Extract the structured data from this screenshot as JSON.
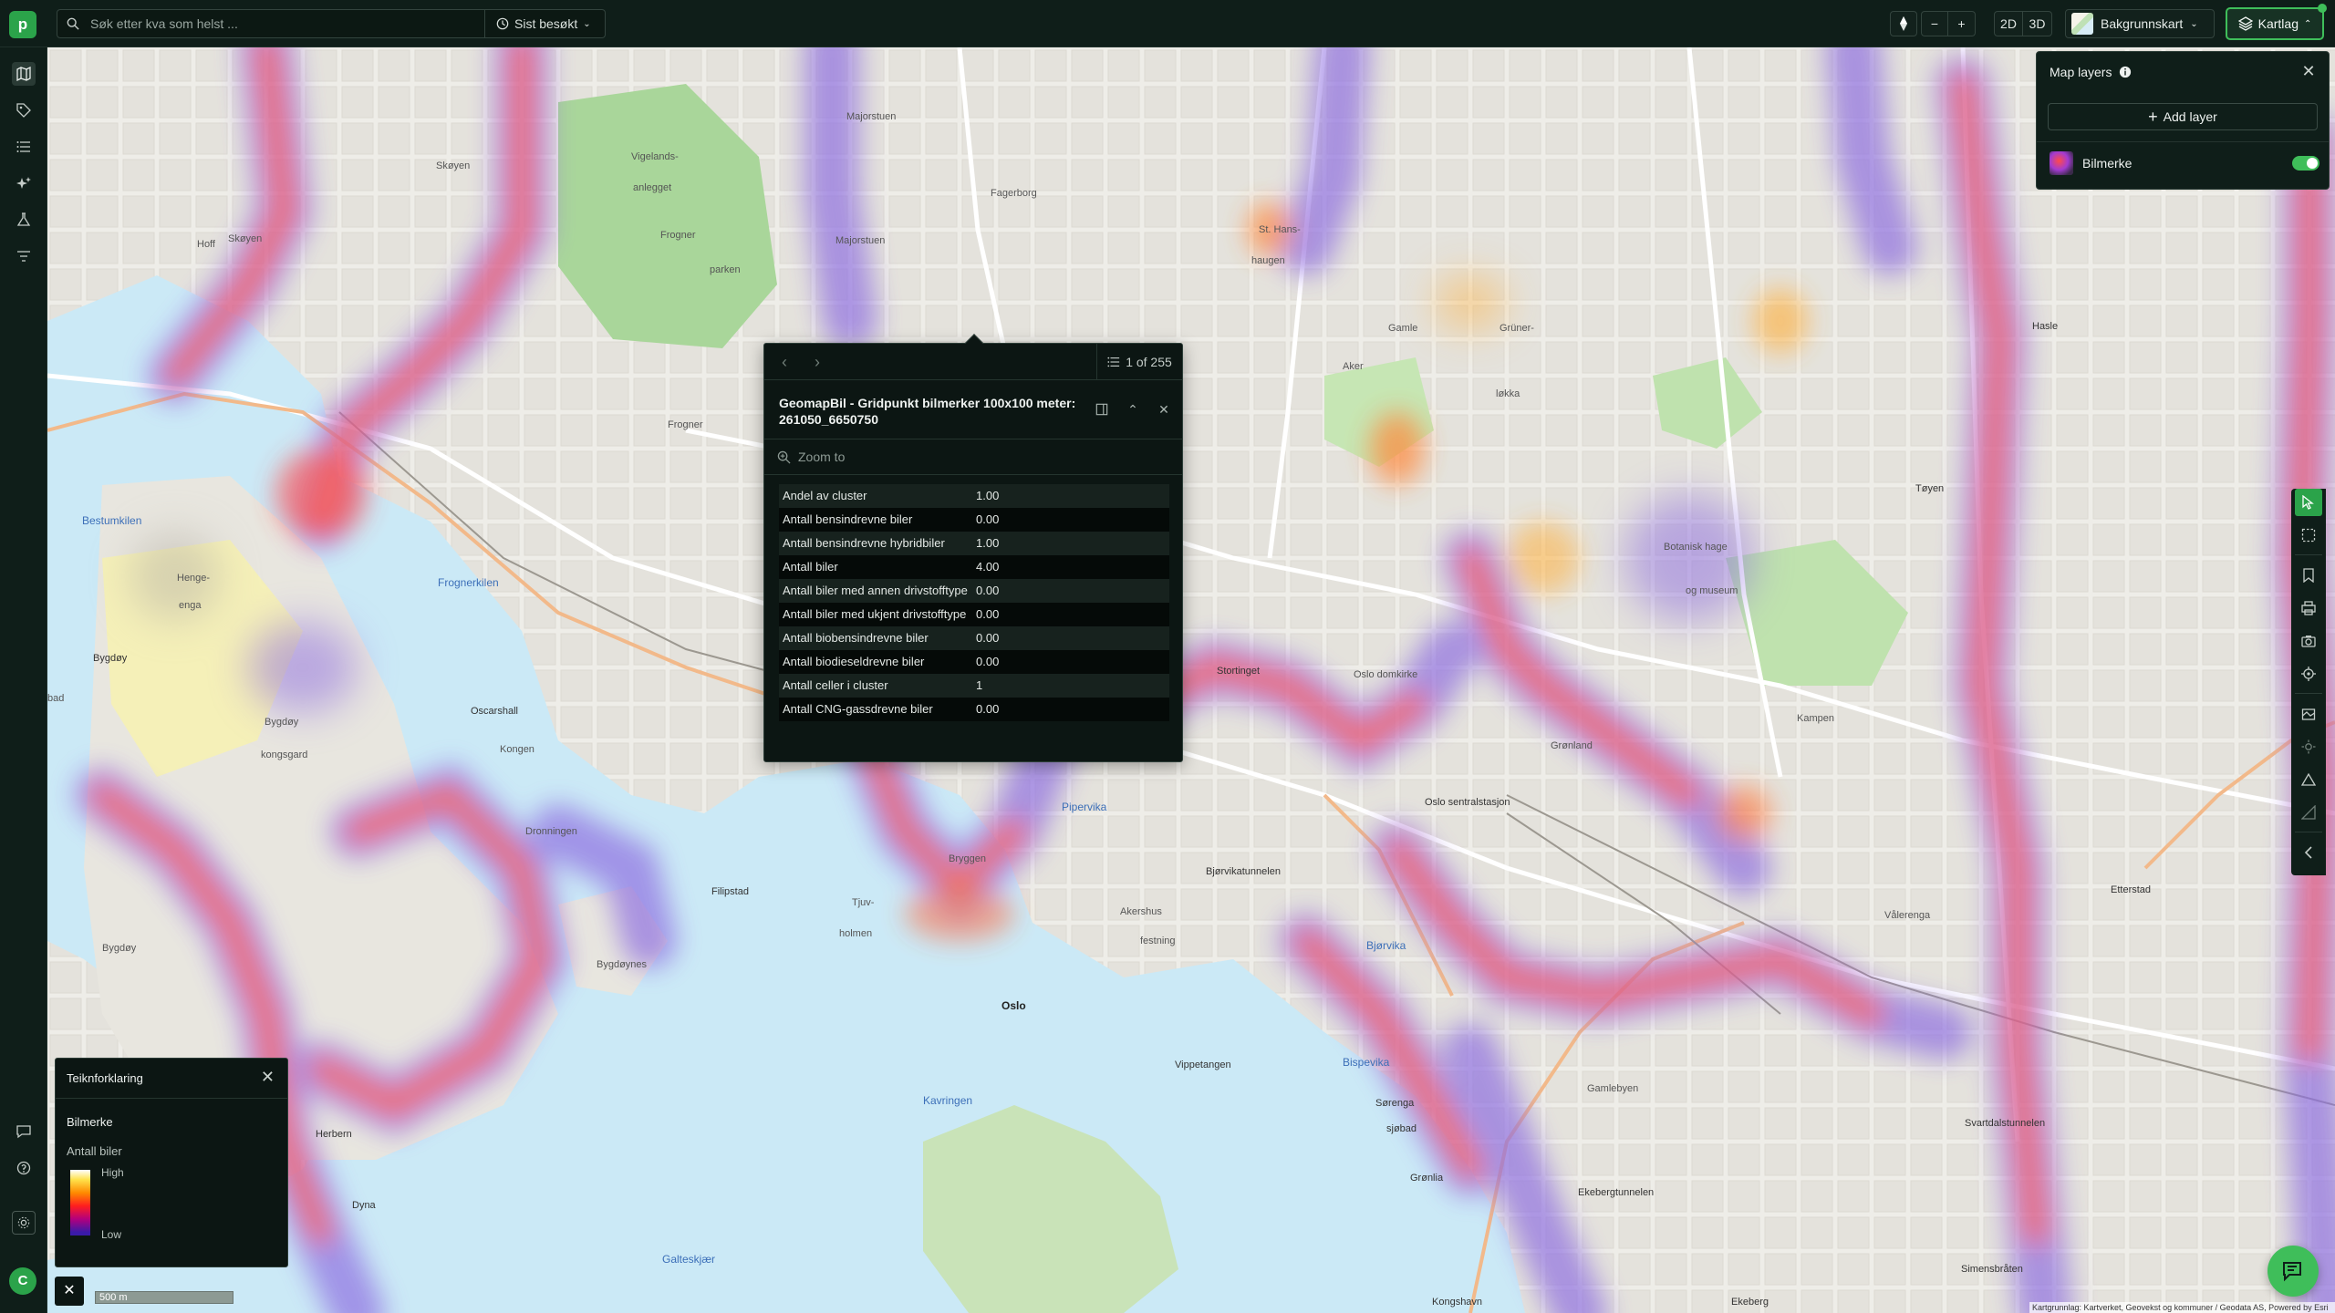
{
  "app": {
    "logo_letter": "p",
    "brand_color": "#2ba34a"
  },
  "search": {
    "placeholder": "Søk etter kva som helst ...",
    "recent_label": "Sist besøkt"
  },
  "toolbar": {
    "zoom_out": "−",
    "zoom_in": "+",
    "mode_2d": "2D",
    "mode_3d": "3D",
    "basemap_label": "Bakgrunnskart",
    "layers_label": "Kartlag"
  },
  "left_rail": {
    "icons": [
      "map-icon",
      "tag-icon",
      "list-icon",
      "sparkles-icon",
      "flask-icon",
      "filter-icon",
      "comment-icon",
      "help-icon",
      "settings-icon"
    ],
    "avatar_letter": "C"
  },
  "popup": {
    "counter": "1 of 255",
    "title": "GeomapBil - Gridpunkt bilmerker 100x100 meter: 261050_6650750",
    "zoom_to": "Zoom to",
    "rows": [
      {
        "key": "Andel av cluster",
        "value": "1.00"
      },
      {
        "key": "Antall bensindrevne biler",
        "value": "0.00"
      },
      {
        "key": "Antall bensindrevne hybridbiler",
        "value": "1.00"
      },
      {
        "key": "Antall biler",
        "value": "4.00"
      },
      {
        "key": "Antall biler med annen drivstofftype",
        "value": "0.00"
      },
      {
        "key": "Antall biler med ukjent drivstofftype",
        "value": "0.00"
      },
      {
        "key": "Antall biobensindrevne biler",
        "value": "0.00"
      },
      {
        "key": "Antall biodieseldrevne biler",
        "value": "0.00"
      },
      {
        "key": "Antall celler i cluster",
        "value": "1"
      },
      {
        "key": "Antall CNG-gassdrevne biler",
        "value": "0.00"
      }
    ]
  },
  "layers_panel": {
    "title": "Map layers",
    "add_layer": "Add layer",
    "layer_name": "Bilmerke",
    "layer_visible": true
  },
  "legend": {
    "title": "Teiknforklaring",
    "layer": "Bilmerke",
    "field": "Antall biler",
    "high": "High",
    "low": "Low"
  },
  "scale": {
    "label": "500 m"
  },
  "attribution": "Kartgrunnlag: Kartverket, Geovekst og kommuner / Geodata AS, Powered by Esri",
  "map_labels": [
    "Majorstuen",
    "Vigelands-",
    "anlegget",
    "Frogner",
    "parken",
    "Skøyen",
    "Hoff",
    "Skøyen",
    "Fagerborg",
    "Majorstuen",
    "St. Hans-",
    "haugen",
    "Gamle",
    "Aker",
    "Grüner-",
    "løkka",
    "Hasle",
    "Frogner",
    "Bestumkilen",
    "Henge-",
    "enga",
    "Frognerkilen",
    "Bygdøy",
    "Oscarshall",
    "Bygdøy",
    "kongsgard",
    "Kongen",
    "Dronningen",
    "Filipstad",
    "Tjuv-",
    "holmen",
    "Pipervika",
    "Akershus",
    "festning",
    "Bygdøynes",
    "Oslo",
    "Bjørvikatunnelen",
    "Bjørvika",
    "Stortinget",
    "Oslo domkirke",
    "Oslo sentralstasjon",
    "Grønland",
    "Botanisk hage",
    "og museum",
    "Tøyen",
    "Kampen",
    "Etterstad",
    "Vålerenga",
    "Vippetangen",
    "Kavringen",
    "Bispevika",
    "Sørenga",
    "sjøbad",
    "Gamlebyen",
    "Svartdalstunnelen",
    "Grønlia",
    "Ekebergtunnelen",
    "Ekeberg",
    "Simensbråten",
    "Kongshavn",
    "Herbern",
    "Dyna",
    "Galteskjær",
    "Bygdøy",
    "bad",
    "Bryggen"
  ]
}
